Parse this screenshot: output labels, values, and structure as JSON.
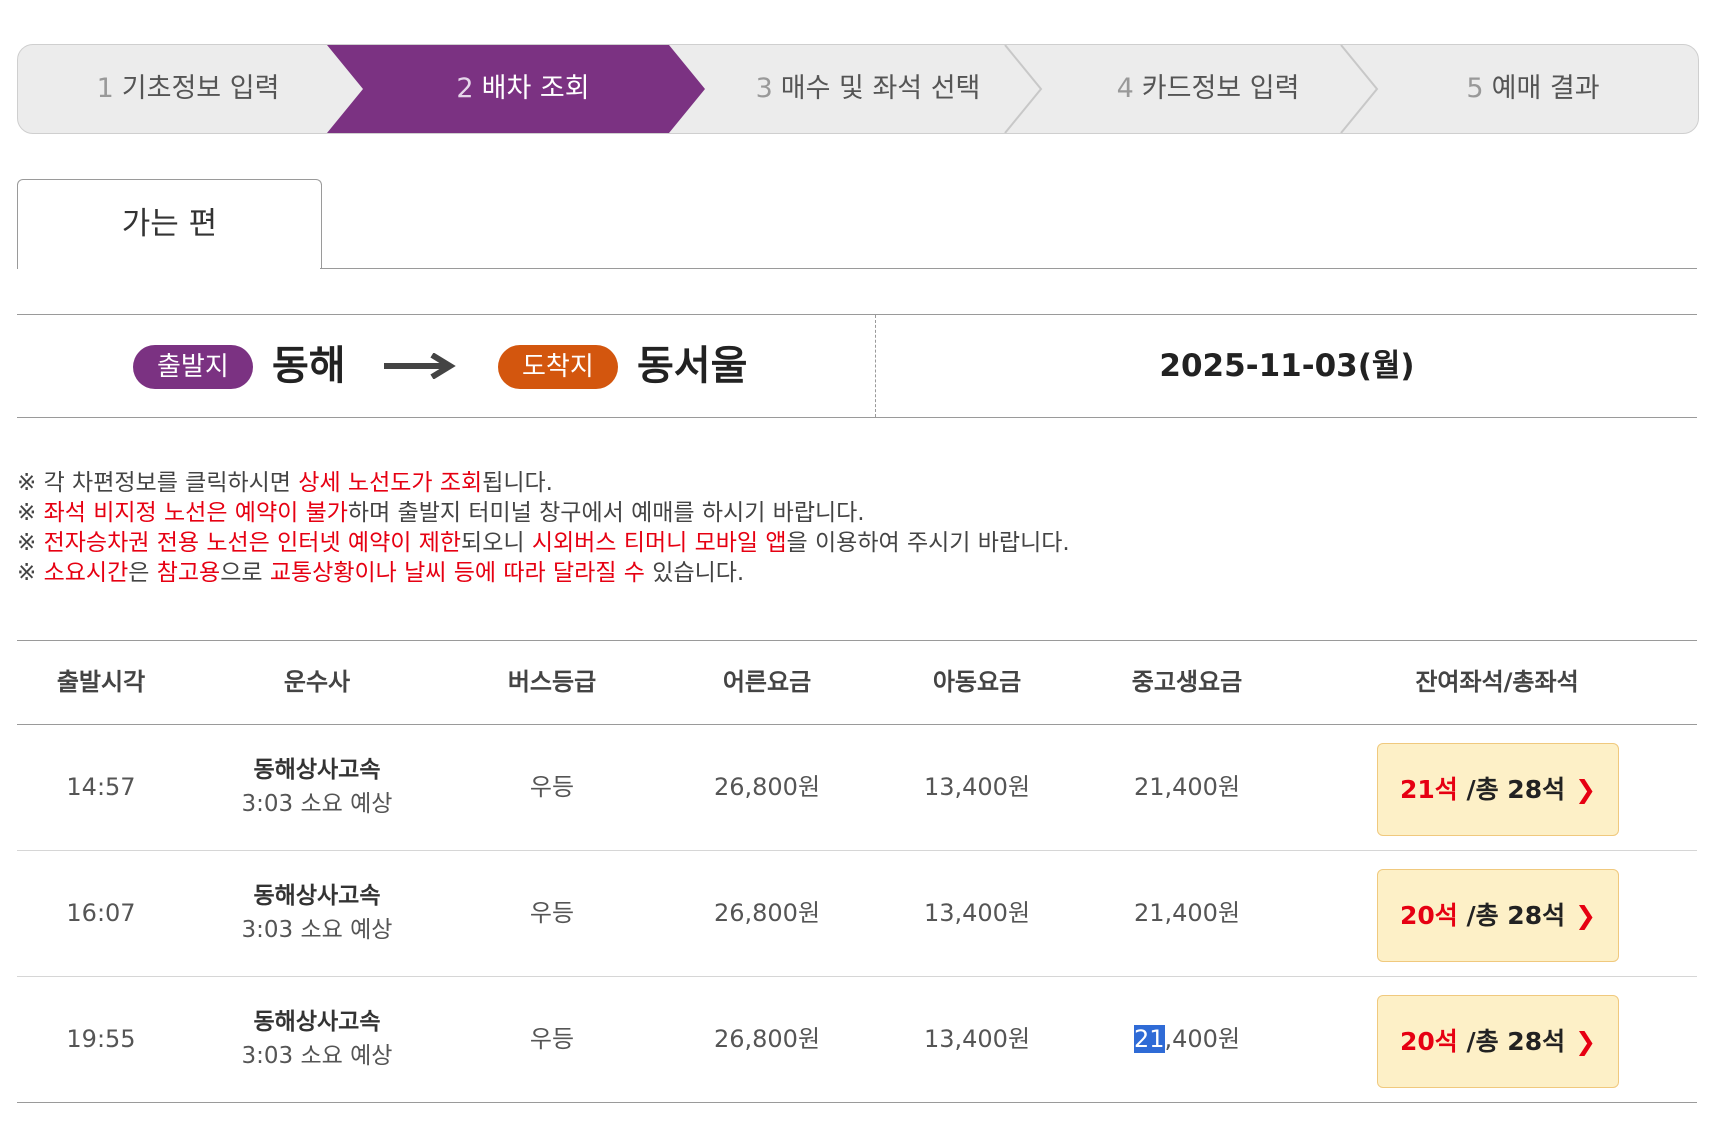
{
  "steps": [
    {
      "num": "1",
      "label": "기초정보 입력",
      "active": false
    },
    {
      "num": "2",
      "label": "배차 조회",
      "active": true
    },
    {
      "num": "3",
      "label": "매수 및 좌석 선택",
      "active": false
    },
    {
      "num": "4",
      "label": "카드정보 입력",
      "active": false
    },
    {
      "num": "5",
      "label": "예매 결과",
      "active": false
    }
  ],
  "tab": {
    "label": "가는 편"
  },
  "route": {
    "departure_badge": "출발지",
    "departure_city": "동해",
    "arrival_badge": "도착지",
    "arrival_city": "동서울",
    "date": "2025-11-03(월)"
  },
  "notices": [
    {
      "parts": [
        {
          "text": "※ 각 차편정보를 클릭하시면 ",
          "red": false
        },
        {
          "text": "상세 노선도가 조회",
          "red": true
        },
        {
          "text": "됩니다.",
          "red": false
        }
      ]
    },
    {
      "parts": [
        {
          "text": "※ ",
          "red": false
        },
        {
          "text": "좌석 비지정 노선은 예약이 불가",
          "red": true
        },
        {
          "text": "하며 출발지 터미널 창구에서 예매를 하시기 바랍니다.",
          "red": false
        }
      ]
    },
    {
      "parts": [
        {
          "text": "※ ",
          "red": false
        },
        {
          "text": "전자승차권 전용 노선은 인터넷 예약이 제한",
          "red": true
        },
        {
          "text": "되오니 ",
          "red": false
        },
        {
          "text": "시외버스 티머니 모바일 앱",
          "red": true
        },
        {
          "text": "을 이용하여 주시기 바랍니다.",
          "red": false
        }
      ]
    },
    {
      "parts": [
        {
          "text": "※ ",
          "red": false
        },
        {
          "text": "소요시간",
          "red": true
        },
        {
          "text": "은 ",
          "red": false
        },
        {
          "text": "참고용",
          "red": true
        },
        {
          "text": "으로 ",
          "red": false
        },
        {
          "text": "교통상황이나 날씨 등에 따라 달라질 수",
          "red": true
        },
        {
          "text": " 있습니다.",
          "red": false
        }
      ]
    }
  ],
  "table": {
    "headers": [
      "출발시각",
      "운수사",
      "버스등급",
      "어른요금",
      "아동요금",
      "중고생요금",
      "잔여좌석/총좌석"
    ],
    "rows": [
      {
        "time": "14:57",
        "company": "동해상사고속",
        "duration": "3:03 소요 예상",
        "grade": "우등",
        "adult": "26,800원",
        "child": "13,400원",
        "student": "21,400원",
        "remaining": "21석",
        "total": "/총 28석"
      },
      {
        "time": "16:07",
        "company": "동해상사고속",
        "duration": "3:03 소요 예상",
        "grade": "우등",
        "adult": "26,800원",
        "child": "13,400원",
        "student": "21,400원",
        "remaining": "20석",
        "total": "/총 28석"
      },
      {
        "time": "19:55",
        "company": "동해상사고속",
        "duration": "3:03 소요 예상",
        "grade": "우등",
        "adult": "26,800원",
        "child": "13,400원",
        "student_selected": "21",
        "student_rest": ",400원",
        "remaining": "20석",
        "total": "/총 28석"
      }
    ]
  },
  "colors": {
    "active_step": "#7b3282",
    "departure_badge": "#7b3282",
    "arrival_badge": "#d3560e",
    "highlight_red": "#e60012",
    "seat_button_bg": "#fdf0c7",
    "text_selection": "#2f6bd6"
  },
  "icons": {
    "route_arrow": "long-right-arrow-icon",
    "seat_chevron": "chevron-right-icon"
  }
}
